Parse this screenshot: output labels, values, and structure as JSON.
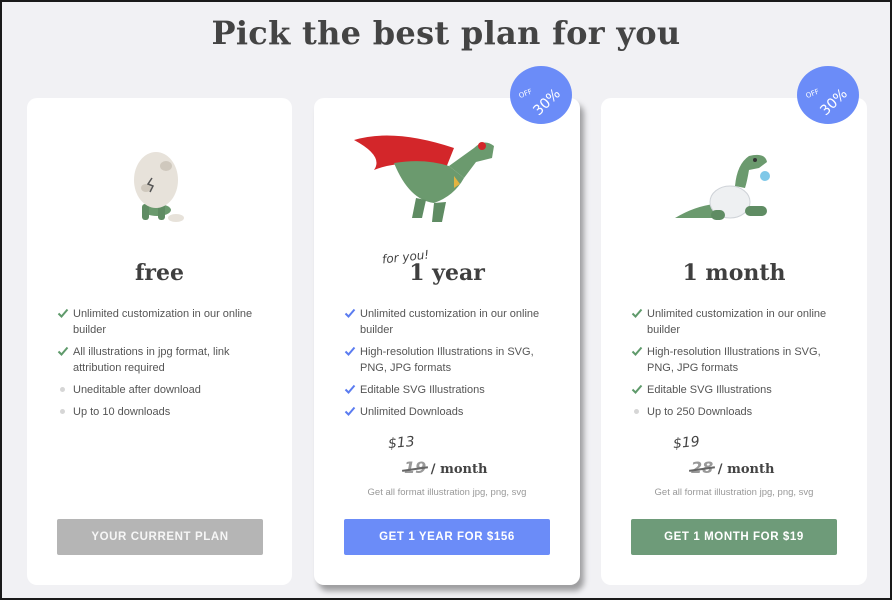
{
  "title": "Pick the best plan for you",
  "colors": {
    "check": "#5f9a6b",
    "check_blue": "#5b7cf0",
    "blue_accent": "#6b8cf8",
    "green_accent": "#6e9b79",
    "grey_button": "#b5b5b5"
  },
  "plans": [
    {
      "name": "free",
      "illustration": "egg-dino-illustration",
      "features": [
        {
          "text": "Unlimited customization in our online builder",
          "icon": "check-icon"
        },
        {
          "text": "All illustrations in jpg format, link attribution required",
          "icon": "check-icon"
        },
        {
          "text": "Uneditable after download",
          "icon": "bullet-dot"
        },
        {
          "text": "Up to 10 downloads",
          "icon": "bullet-dot"
        }
      ],
      "button_label": "YOUR CURRENT PLAN"
    },
    {
      "name": "1 year",
      "tagline": "for you!",
      "badge": {
        "value": "30%",
        "suffix": "OFF"
      },
      "illustration": "superhero-dino-illustration",
      "features": [
        {
          "text": "Unlimited customization in our online builder",
          "icon": "check-icon"
        },
        {
          "text": "High-resolution Illustrations in SVG, PNG, JPG formats",
          "icon": "check-icon"
        },
        {
          "text": "Editable SVG Illustrations",
          "icon": "check-icon"
        },
        {
          "text": "Unlimited Downloads",
          "icon": "check-icon"
        }
      ],
      "price_new": "$13",
      "price_old": "19",
      "price_unit": "/ month",
      "price_note": "Get all format illustration jpg, png, svg",
      "button_label": "GET 1 YEAR FOR $156"
    },
    {
      "name": "1 month",
      "badge": {
        "value": "30%",
        "suffix": "OFF"
      },
      "illustration": "baby-dino-illustration",
      "features": [
        {
          "text": "Unlimited customization in our online builder",
          "icon": "check-icon"
        },
        {
          "text": "High-resolution Illustrations in SVG, PNG, JPG formats",
          "icon": "check-icon"
        },
        {
          "text": "Editable SVG Illustrations",
          "icon": "check-icon"
        },
        {
          "text": "Up to 250 Downloads",
          "icon": "bullet-dot"
        }
      ],
      "price_new": "$19",
      "price_old": "28",
      "price_unit": "/ month",
      "price_note": "Get all format illustration jpg, png, svg",
      "button_label": "GET 1 MONTH FOR $19"
    }
  ]
}
